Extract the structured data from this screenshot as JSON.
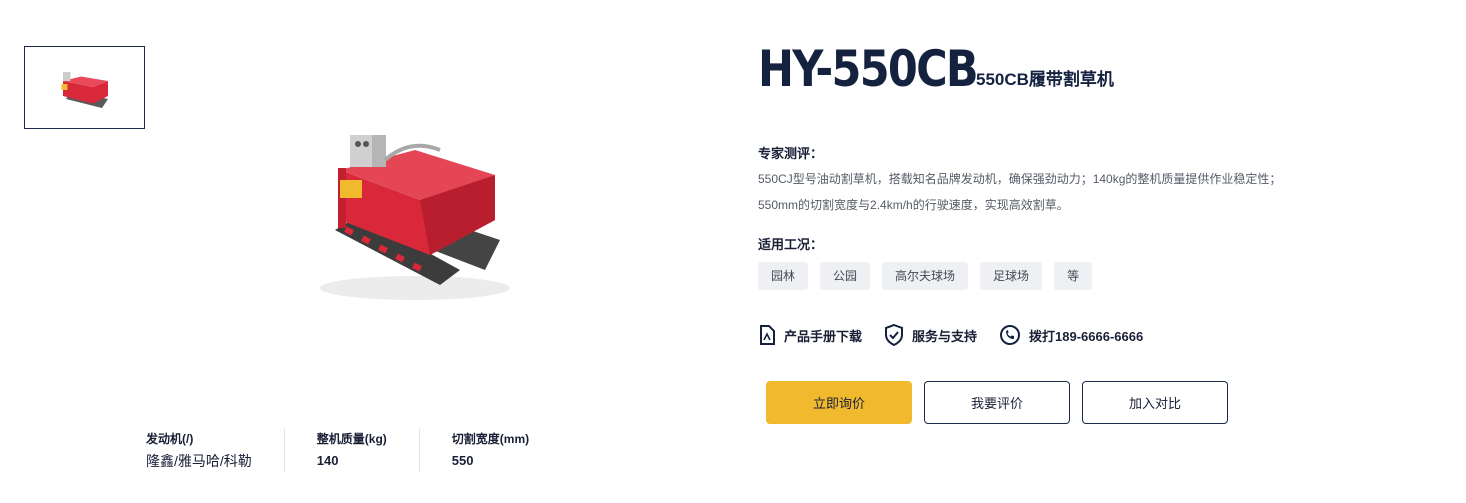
{
  "product": {
    "model": "HY-550CB",
    "name": "550CB履带割草机"
  },
  "gallery": {
    "thumbnail_icon": "crawler-mower-image",
    "main_icon": "crawler-mower-image"
  },
  "review": {
    "label": "专家测评：",
    "line1": "550CJ型号油动割草机，搭载知名品牌发动机，确保强劲动力；140kg的整机质量提供作业稳定性；",
    "line2": "550mm的切割宽度与2.4km/h的行驶速度，实现高效割草。"
  },
  "conditions": {
    "label": "适用工况：",
    "tags": [
      "园林",
      "公园",
      "高尔夫球场",
      "足球场",
      "等"
    ]
  },
  "links": {
    "manual": {
      "label": "产品手册下载",
      "icon": "pdf-file-icon"
    },
    "service": {
      "label": "服务与支持",
      "icon": "shield-check-icon"
    },
    "phone": {
      "label": "拨打189-6666-6666",
      "icon": "phone-icon"
    }
  },
  "actions": {
    "inquiry": "立即询价",
    "rate": "我要评价",
    "compare": "加入对比"
  },
  "specs": [
    {
      "label": "发动机(/)",
      "value": "隆鑫/雅马哈/科勒"
    },
    {
      "label": "整机质量(kg)",
      "value": "140"
    },
    {
      "label": "切割宽度(mm)",
      "value": "550"
    }
  ],
  "colors": {
    "accent": "#f0b92e",
    "brand_dark": "#14213f",
    "product_red": "#d8283a"
  }
}
